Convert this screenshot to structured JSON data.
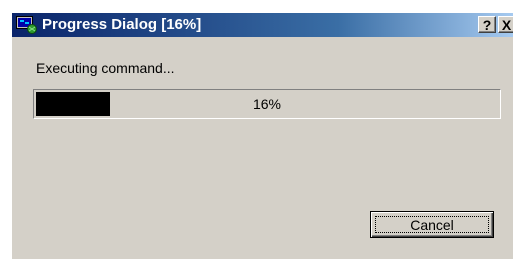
{
  "window": {
    "title": "Progress Dialog [16%]",
    "icon": "app-monitor-icon",
    "help_label": "?",
    "close_label": "X"
  },
  "status": {
    "message": "Executing command..."
  },
  "progress": {
    "value": 0.16,
    "label": "16%",
    "fill_color": "#000000"
  },
  "buttons": {
    "cancel_label": "Cancel"
  },
  "colors": {
    "titlebar_start": "#0a246a",
    "titlebar_end": "#a6caf0",
    "face": "#d4d0c8"
  }
}
